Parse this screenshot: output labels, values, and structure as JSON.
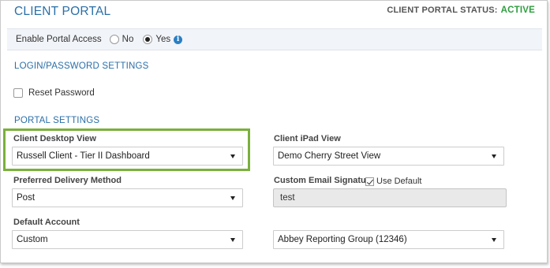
{
  "header": {
    "title": "CLIENT PORTAL",
    "status_label": "CLIENT PORTAL STATUS:",
    "status_value": "ACTIVE",
    "status_color": "#2e9e3e"
  },
  "access": {
    "label": "Enable Portal Access",
    "options": [
      {
        "label": "No",
        "selected": false
      },
      {
        "label": "Yes",
        "selected": true
      }
    ],
    "info_icon": "info-icon"
  },
  "login": {
    "heading": "LOGIN/PASSWORD SETTINGS",
    "reset_password_label": "Reset Password",
    "reset_password_checked": false
  },
  "portal": {
    "heading": "PORTAL SETTINGS",
    "desktop_view": {
      "label": "Client Desktop View",
      "value": "Russell Client - Tier II Dashboard"
    },
    "ipad_view": {
      "label": "Client iPad View",
      "value": "Demo Cherry Street View"
    },
    "delivery": {
      "label": "Preferred Delivery Method",
      "value": "Post"
    },
    "email_signature": {
      "label": "Custom Email Signature",
      "use_default_label": "Use Default",
      "use_default_checked": true,
      "value": "test"
    },
    "default_account": {
      "label": "Default Account",
      "value": "Custom"
    },
    "reporting_group": {
      "value": "Abbey Reporting Group (12346)"
    }
  },
  "colors": {
    "accent": "#2a6fa8",
    "highlight": "#7ab03c"
  }
}
